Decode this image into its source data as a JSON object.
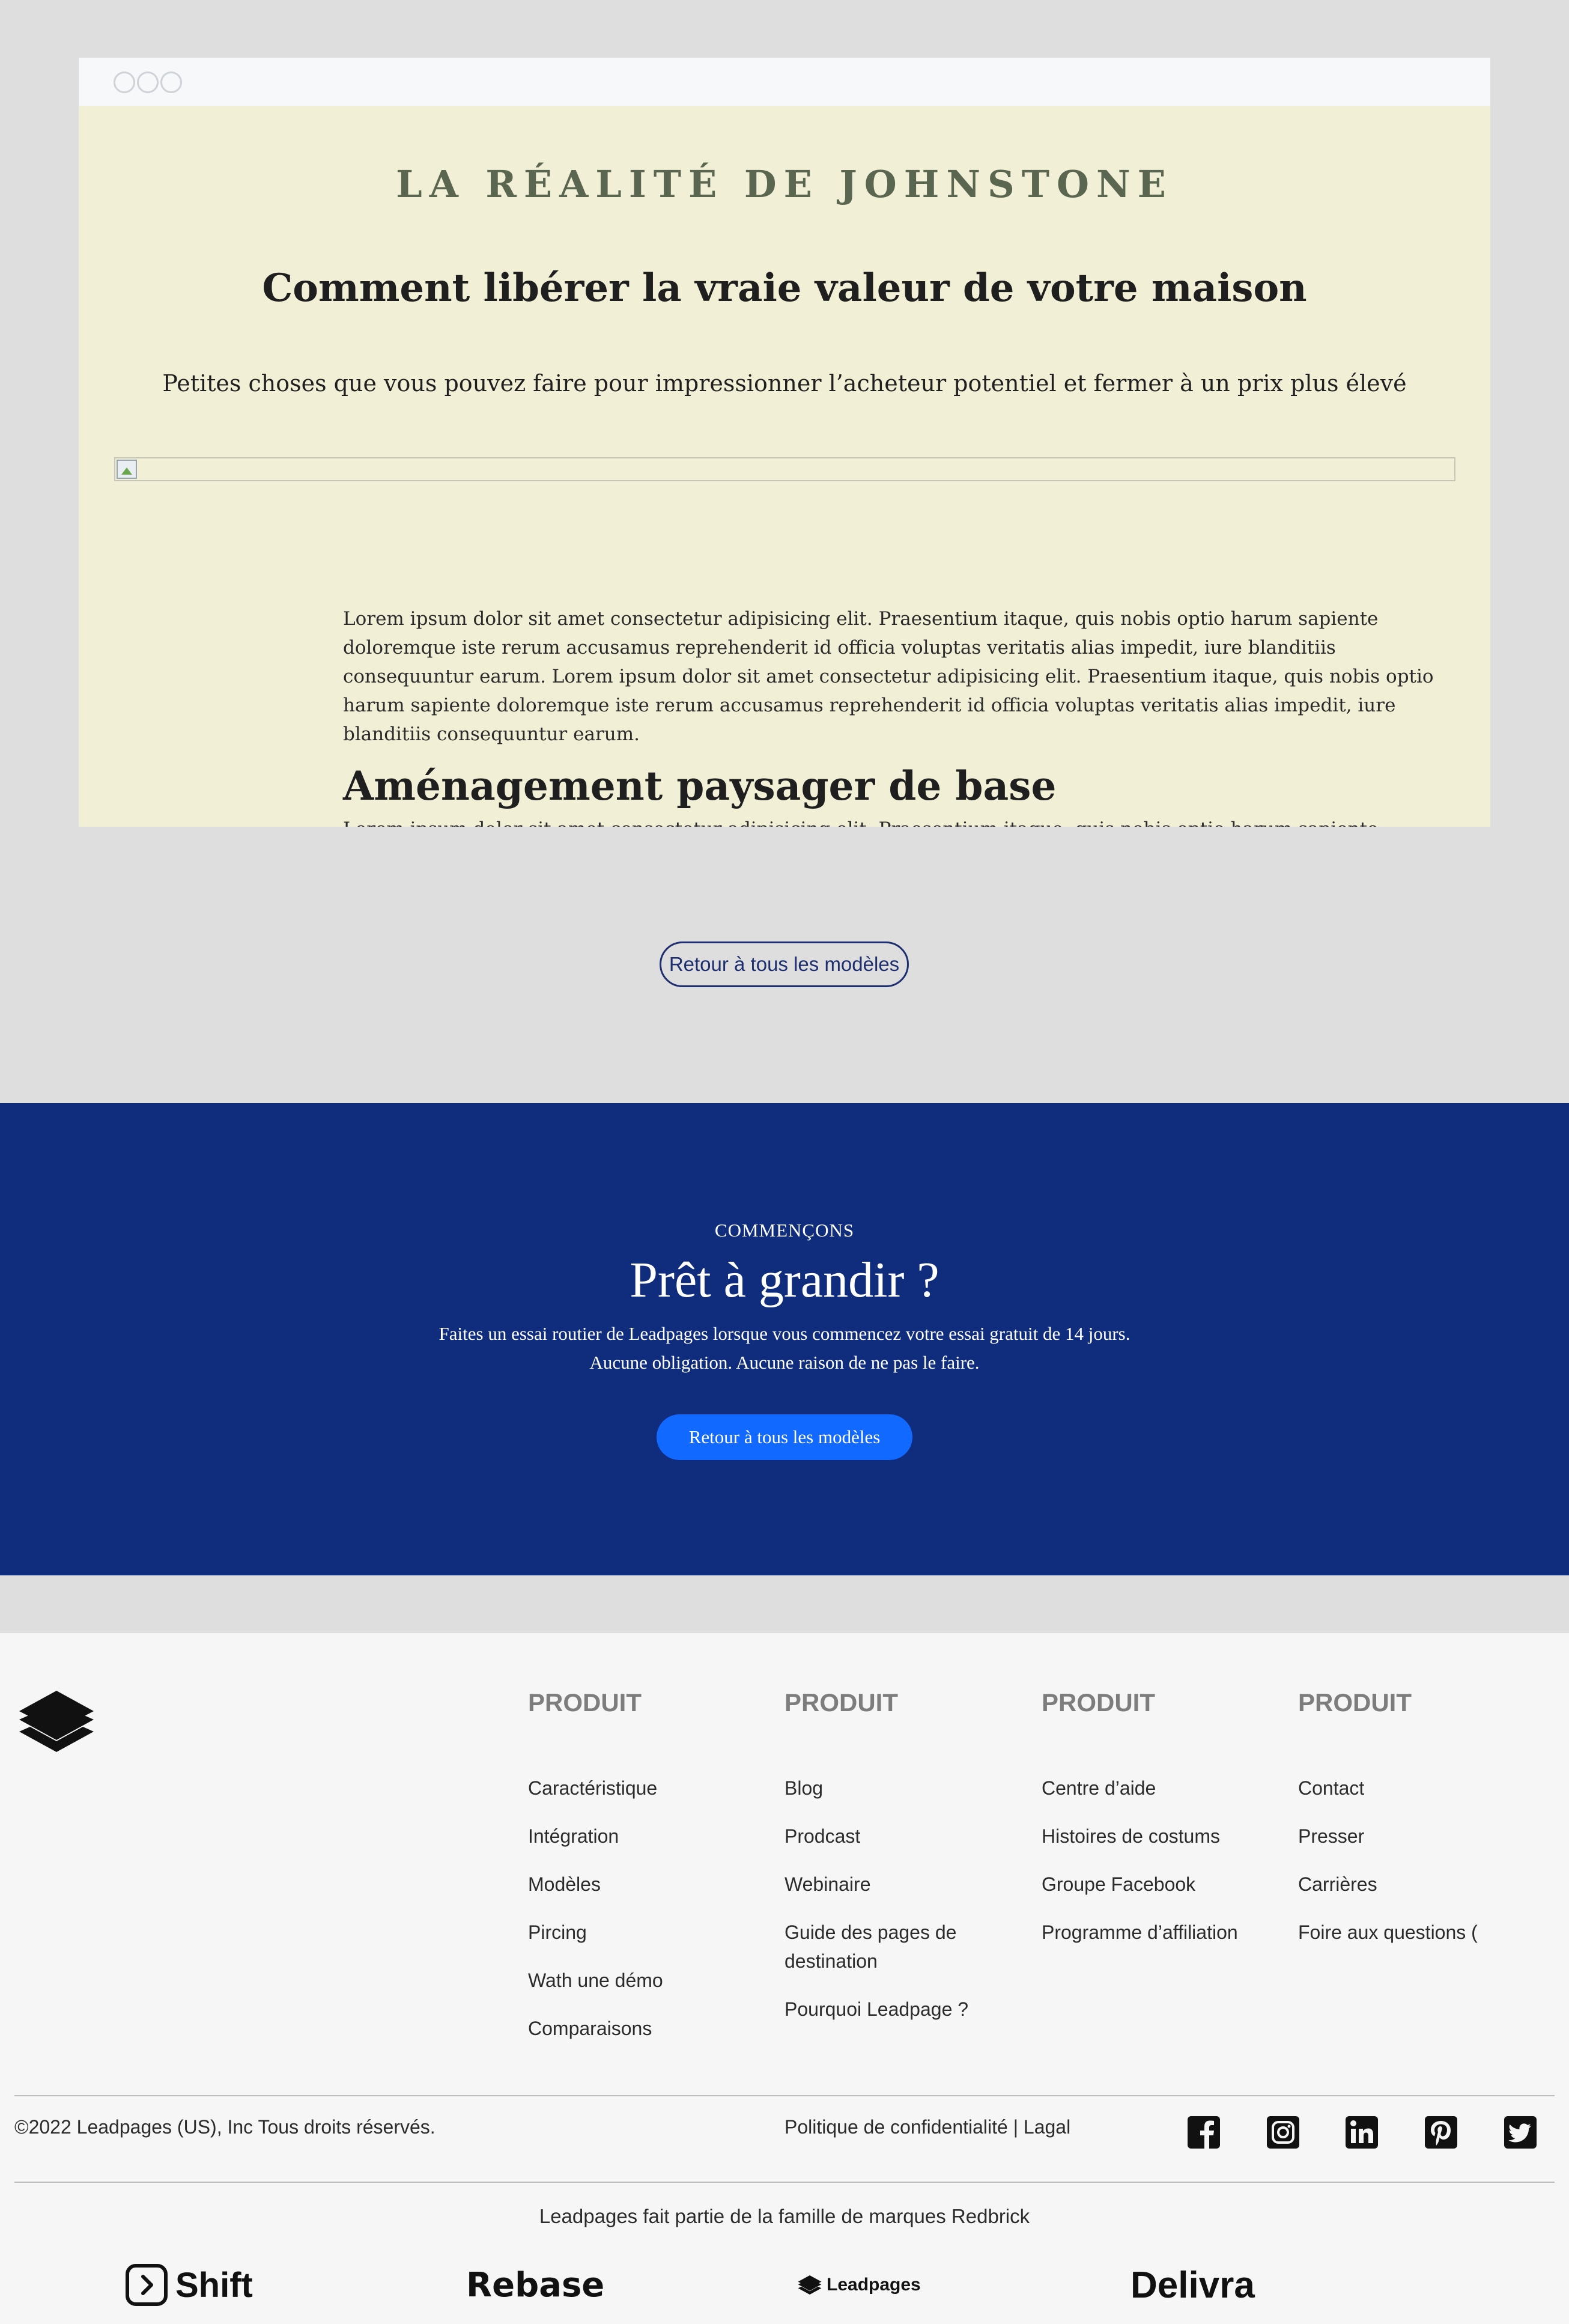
{
  "preview": {
    "eyebrow": "LA RÉALITÉ DE JOHNSTONE",
    "headline": "Comment libérer la vraie valeur de votre maison",
    "subhead": "Petites choses que vous pouvez faire pour impressionner l’acheteur potentiel et fermer à un prix plus élevé",
    "paragraph1": "Lorem ipsum dolor sit amet consectetur adipisicing elit. Praesentium itaque, quis nobis optio harum sapiente doloremque iste rerum accusamus reprehenderit id officia voluptas veritatis alias impedit, iure blanditiis consequuntur earum. Lorem ipsum dolor sit amet consectetur adipisicing elit. Praesentium itaque, quis nobis optio harum sapiente doloremque iste rerum accusamus reprehenderit id officia voluptas veritatis alias impedit, iure blanditiis consequuntur earum.",
    "section_title": "Aménagement paysager de base",
    "paragraph2": "Lorem ipsum dolor sit amet consectetur adipisicing elit. Praesentium itaque, quis nobis optio harum sapiente doloremque iste rerum accusamus reprehenderit id officia voluptas veritatis alias impedit, iure blanditiis consequuntur earum. Lorem ipsum dolor sit amet consectetur adipisicing elit. Praesentium itaque, quis nobis optio harum sapiente doloremque iste rerum accusamus"
  },
  "back_button": "Retour à tous les modèles",
  "cta": {
    "kicker": "COMMENÇONS",
    "title": "Prêt à grandir ?",
    "line1": "Faites un essai routier de Leadpages lorsque vous commencez votre essai gratuit de 14 jours.",
    "line2": "Aucune obligation. Aucune raison de ne pas le faire.",
    "button": "Retour à tous les modèles"
  },
  "footer": {
    "columns": [
      {
        "head": "PRODUIT",
        "links": [
          "Caractéristique",
          "Intégration",
          "Modèles",
          "Pircing",
          "Wath une démo",
          "Comparaisons"
        ]
      },
      {
        "head": "PRODUIT",
        "links": [
          "Blog",
          "Prodcast",
          "Webinaire",
          "Guide des pages de destination",
          "Pourquoi Leadpage ?"
        ]
      },
      {
        "head": "PRODUIT",
        "links": [
          "Centre d’aide",
          "Histoires de costums",
          "Groupe Facebook",
          "Programme d’affiliation"
        ]
      },
      {
        "head": "PRODUIT",
        "links": [
          "Contact",
          "Presser",
          "Carrières",
          "Foire aux questions ("
        ]
      }
    ],
    "copyright": "©2022 Leadpages (US), Inc Tous droits réservés.",
    "legal": "Politique de confidentialité | Lagal",
    "social_icons": [
      "facebook-icon",
      "instagram-icon",
      "linkedin-icon",
      "pinterest-icon",
      "twitter-icon"
    ],
    "family_text": "Leadpages fait partie de la famille de marques Redbrick",
    "brands": {
      "shift": "Shift",
      "rebase": "Rebase",
      "leadpages": "Leadpages",
      "delivra": "Delivra"
    }
  }
}
